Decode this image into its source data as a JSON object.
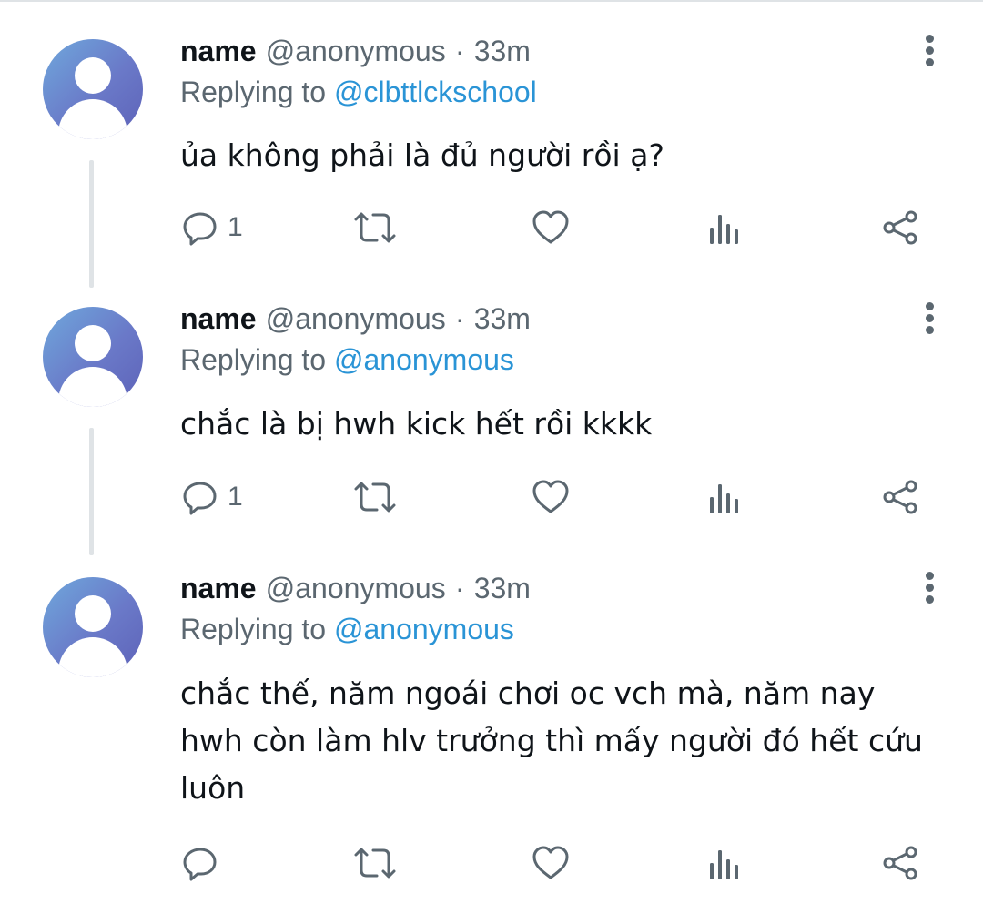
{
  "tweets": [
    {
      "name": "name",
      "handle": "@anonymous",
      "separator": "·",
      "time": "33m",
      "replying_prefix": "Replying to",
      "replying_to": "@clbttlckschool",
      "text": "ủa không phải là đủ người rồi ạ?",
      "reply_count": "1",
      "icons": [
        "reply-icon",
        "retweet-icon",
        "like-icon",
        "views-icon",
        "share-icon",
        "more-icon"
      ]
    },
    {
      "name": "name",
      "handle": "@anonymous",
      "separator": "·",
      "time": "33m",
      "replying_prefix": "Replying to",
      "replying_to": "@anonymous",
      "text": "chắc là bị hwh kick hết rồi kkkk",
      "reply_count": "1",
      "icons": [
        "reply-icon",
        "retweet-icon",
        "like-icon",
        "views-icon",
        "share-icon",
        "more-icon"
      ]
    },
    {
      "name": "name",
      "handle": "@anonymous",
      "separator": "·",
      "time": "33m",
      "replying_prefix": "Replying to",
      "replying_to": "@anonymous",
      "text": "chắc thế, năm ngoái chơi oc vch mà, năm nay hwh còn làm hlv trưởng thì mấy người đó hết cứu luôn",
      "reply_count": "",
      "icons": [
        "reply-icon",
        "retweet-icon",
        "like-icon",
        "views-icon",
        "share-icon",
        "more-icon"
      ]
    }
  ],
  "colors": {
    "secondary_text": "#5b6770",
    "link": "#2a94d6",
    "primary_text": "#0f1419",
    "divider": "#dfe3e6"
  }
}
